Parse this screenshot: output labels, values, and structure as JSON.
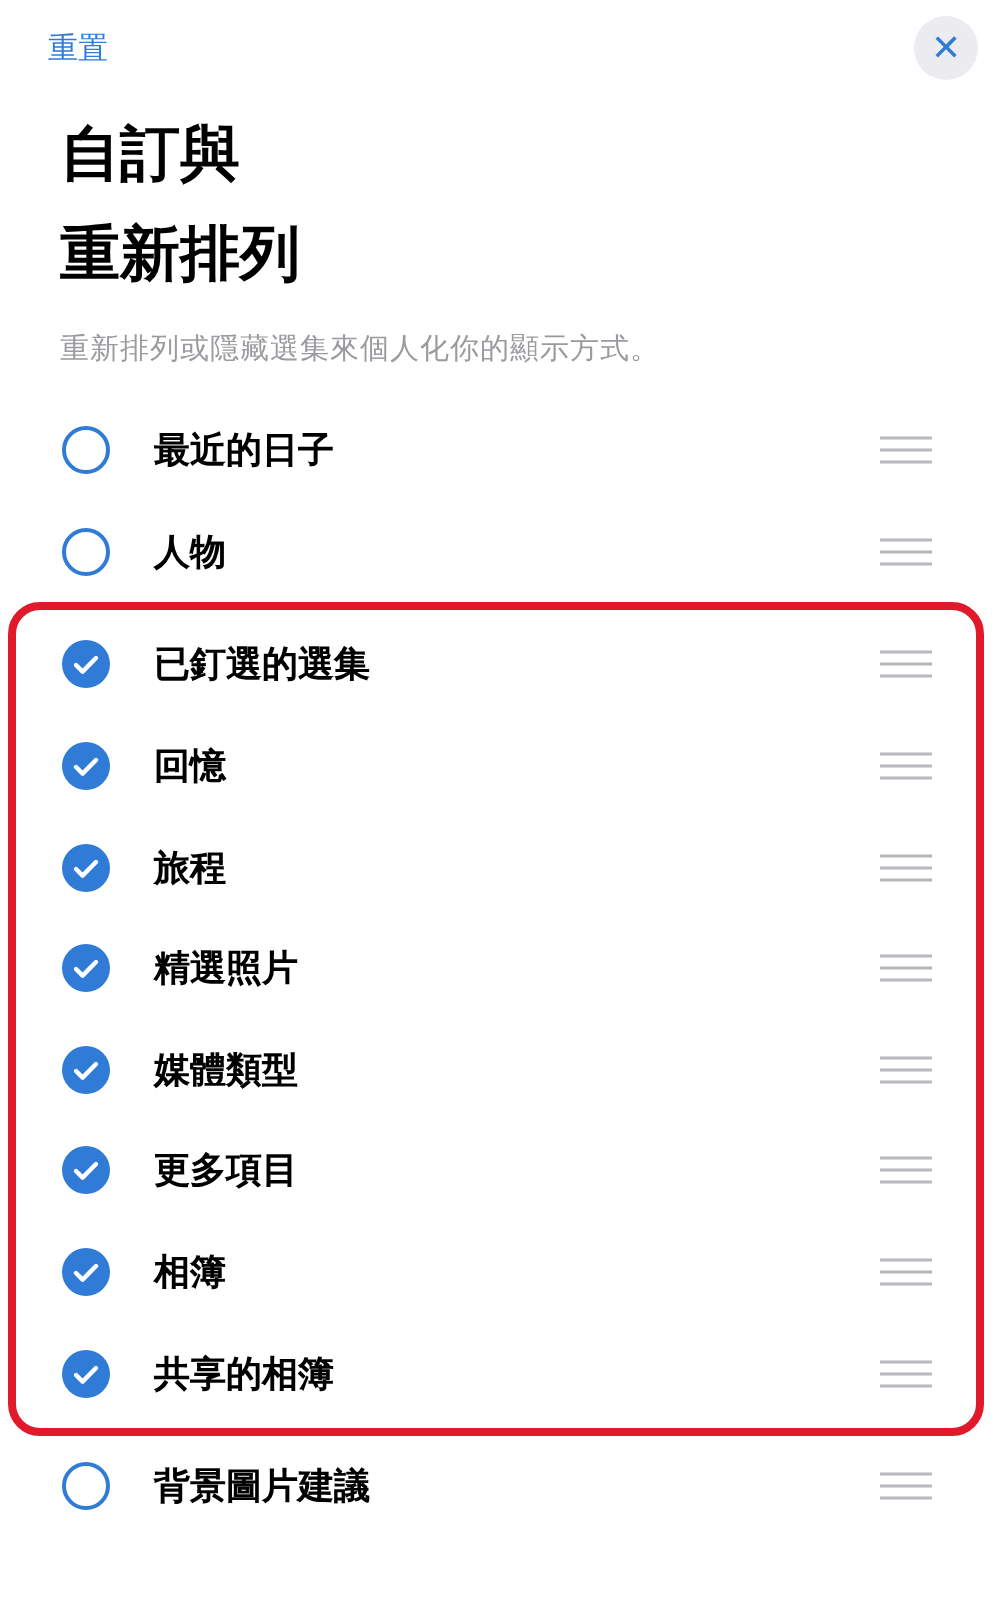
{
  "top_bar": {
    "reset": "重置",
    "close": "✕"
  },
  "title_lines": [
    "自訂與",
    "重新排列"
  ],
  "subtitle": "重新排列或隱藏選集來個人化你的顯示方式。",
  "items_before": [
    {
      "label": "最近的日子",
      "checked": false
    },
    {
      "label": "人物",
      "checked": false
    }
  ],
  "highlighted_items": [
    {
      "label": "已釘選的選集",
      "checked": true
    },
    {
      "label": "回憶",
      "checked": true
    },
    {
      "label": "旅程",
      "checked": true
    },
    {
      "label": "精選照片",
      "checked": true
    },
    {
      "label": "媒體類型",
      "checked": true
    },
    {
      "label": "更多項目",
      "checked": true
    },
    {
      "label": "相簿",
      "checked": true
    },
    {
      "label": "共享的相簿",
      "checked": true
    }
  ],
  "items_after": [
    {
      "label": "背景圖片建議",
      "checked": false
    }
  ]
}
